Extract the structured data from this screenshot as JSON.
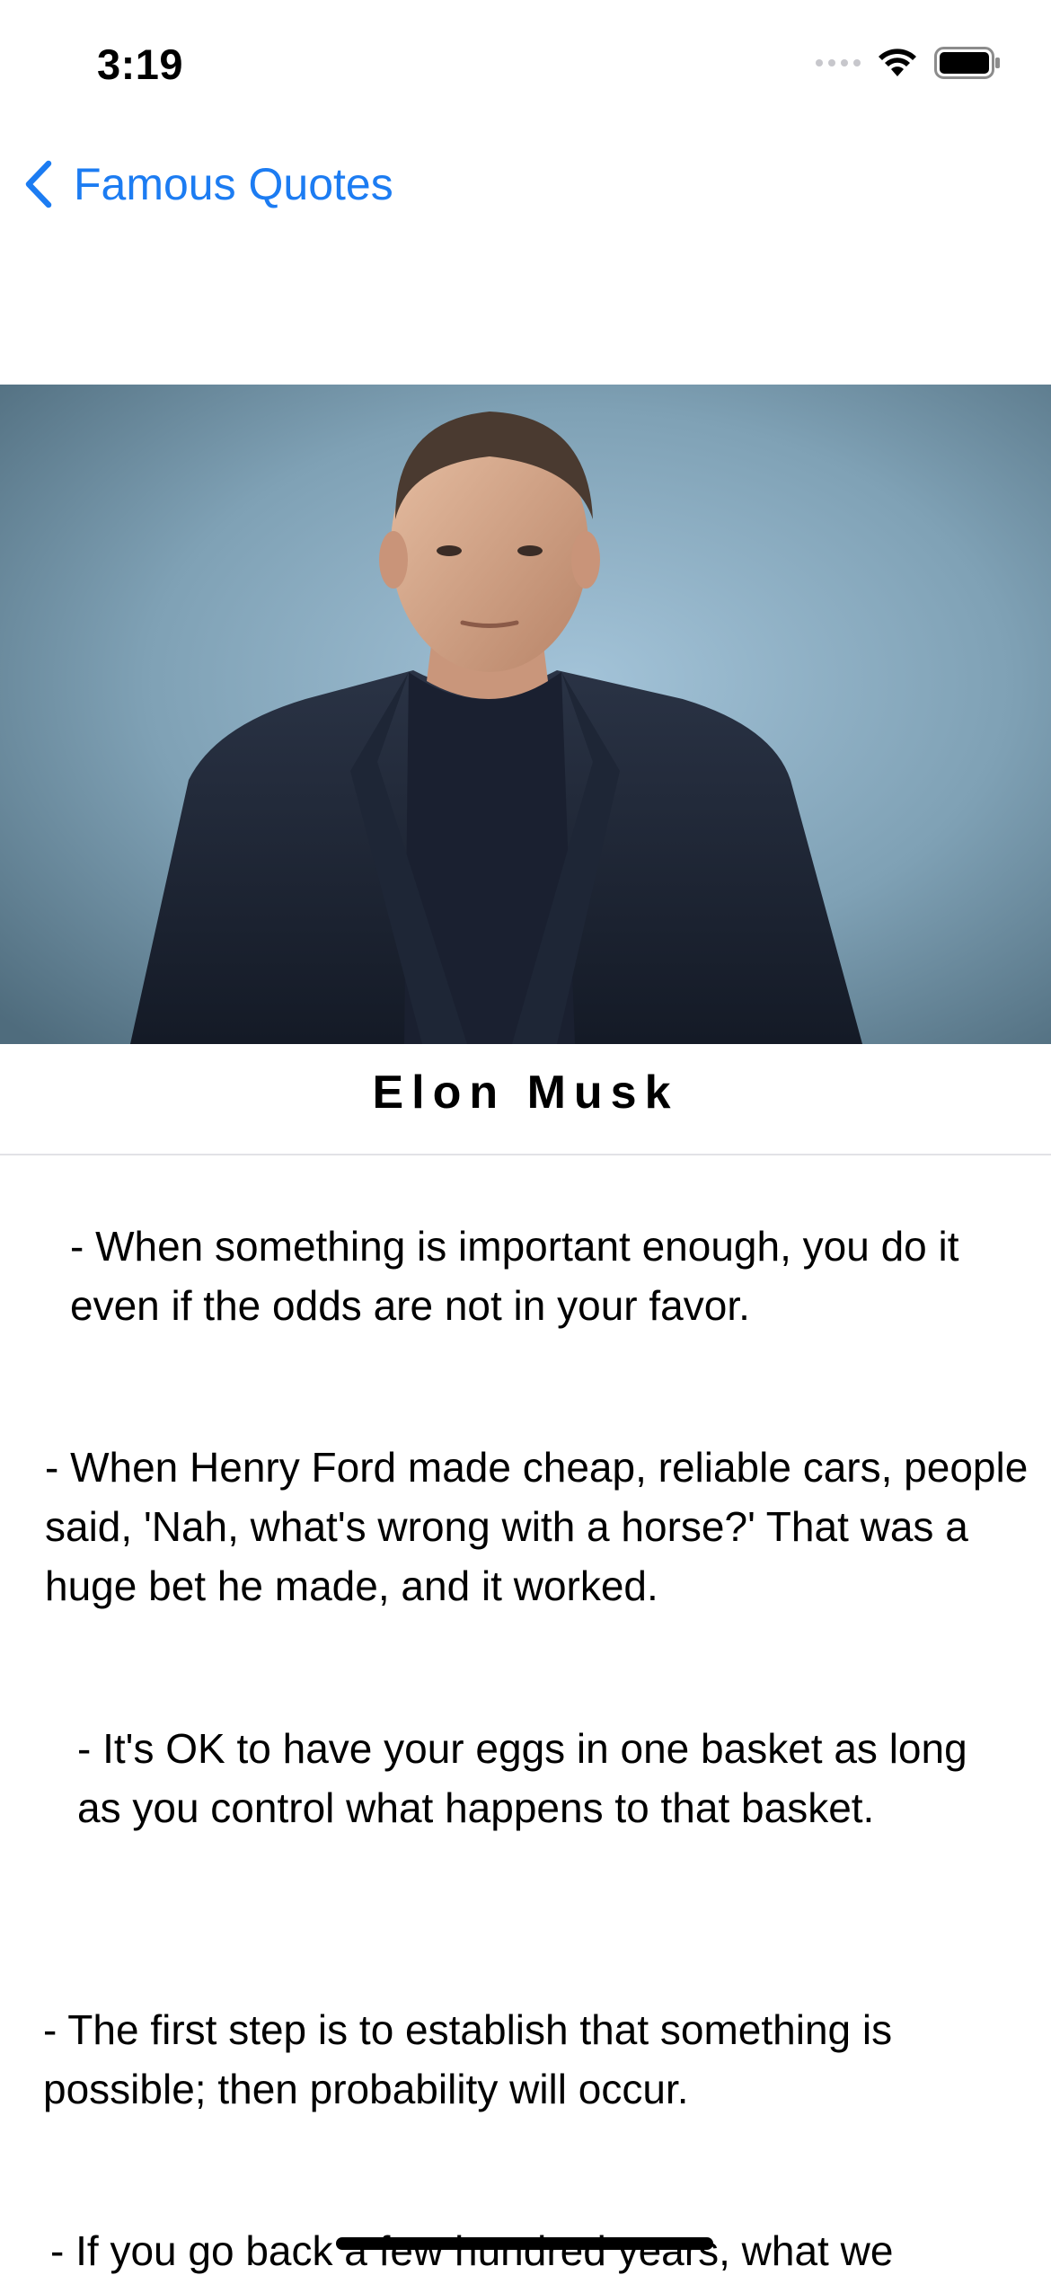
{
  "status_bar": {
    "time": "3:19"
  },
  "nav": {
    "back_label": "Famous Quotes",
    "accent_color": "#1c7cf2"
  },
  "person": {
    "name": "Elon Musk"
  },
  "quotes": [
    "- When something is important enough, you do it even if the odds are not in your favor.",
    "- When Henry Ford made cheap, reliable cars, people said, 'Nah, what's wrong with a horse?' That was a huge bet he made, and it worked.",
    "- It's OK to have your eggs in one basket as long as you control what happens to that basket.",
    "- The first step is to establish that something is possible; then probability will occur.",
    "- If you go back a few hundred years, what we"
  ]
}
